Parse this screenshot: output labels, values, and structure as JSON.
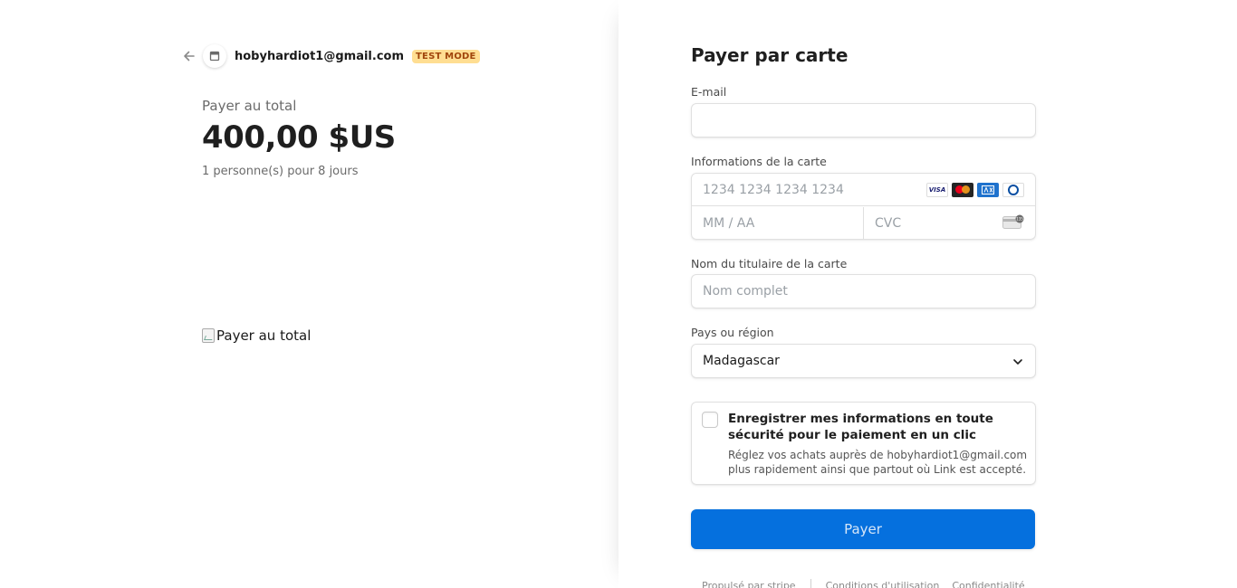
{
  "merchant": {
    "email": "hobyhardiot1@gmail.com",
    "badge": "TEST MODE"
  },
  "summary": {
    "total_label": "Payer au total",
    "total_amount": "400,00 $US",
    "description": "1 personne(s) pour 8 jours",
    "image_alt": "Payer au total"
  },
  "form": {
    "title": "Payer par carte",
    "email_label": "E-mail",
    "email_value": "",
    "card_label": "Informations de la carte",
    "card_number_placeholder": "1234 1234 1234 1234",
    "card_brands": [
      "visa",
      "mastercard",
      "amex",
      "diners"
    ],
    "expiry_placeholder": "MM / AA",
    "cvc_placeholder": "CVC",
    "name_label": "Nom du titulaire de la carte",
    "name_placeholder": "Nom complet",
    "country_label": "Pays ou région",
    "country_value": "Madagascar",
    "link_title": "Enregistrer mes informations en toute sécurité pour le paiement en un clic",
    "link_description": "Réglez vos achats auprès de hobyhardiot1@gmail.com plus rapidement ainsi que partout où Link est accepté.",
    "link_checked": false,
    "pay_button": "Payer"
  },
  "footer": {
    "powered_by": "Propulsé par stripe",
    "terms": "Conditions d'utilisation",
    "privacy": "Confidentialité"
  },
  "colors": {
    "accent": "#0570de",
    "badge_bg": "#ffde92",
    "badge_text": "#a0450b"
  }
}
